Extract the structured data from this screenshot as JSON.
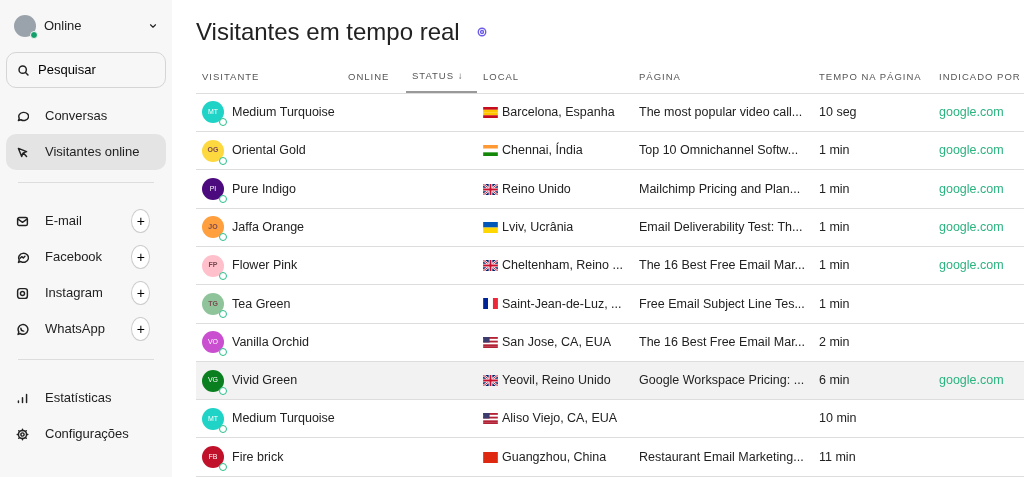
{
  "user": {
    "status": "Online",
    "online": true
  },
  "search": {
    "label": "Pesquisar"
  },
  "nav_sections": [
    {
      "items": [
        {
          "label": "Conversas",
          "kind": "chat",
          "selected": false
        },
        {
          "label": "Visitantes online",
          "kind": "cursor",
          "selected": true
        }
      ]
    },
    {
      "items": [
        {
          "label": "E-mail",
          "kind": "mail",
          "selected": false,
          "add_label": "+"
        },
        {
          "label": "Facebook",
          "kind": "messenger",
          "selected": false,
          "add_label": "+"
        },
        {
          "label": "Instagram",
          "kind": "instagram",
          "selected": false,
          "add_label": "+"
        },
        {
          "label": "WhatsApp",
          "kind": "whatsapp",
          "selected": false,
          "add_label": "+"
        }
      ]
    },
    {
      "items": [
        {
          "label": "Estatísticas",
          "kind": "bars",
          "selected": false
        },
        {
          "label": "Configurações",
          "kind": "gear",
          "selected": false
        }
      ]
    }
  ],
  "page_title": "Visitantes em tempo real",
  "table": {
    "columns": [
      {
        "label": "VISITANTE",
        "sorted": false
      },
      {
        "label": "ONLINE",
        "sorted": false
      },
      {
        "label": "STATUS",
        "sorted": true,
        "sort_arrow": "↓"
      },
      {
        "label": "LOCAL",
        "sorted": false
      },
      {
        "label": "PÁGINA",
        "sorted": false
      },
      {
        "label": "TEMPO NA PÁGINA",
        "sorted": false
      },
      {
        "label": "INDICADO POR",
        "sorted": false
      }
    ],
    "rows": [
      {
        "initials": "MT",
        "color": "#1fd3c6",
        "name": "Medium Turquoise",
        "online": true,
        "flag": {
          "kind": "spain"
        },
        "location": "Barcelona, Espanha",
        "page": "The most popular video call...",
        "time": "10 seg",
        "referrer": "google.com",
        "selected": false
      },
      {
        "initials": "OG",
        "color": "#fdd83f",
        "name": "Oriental Gold",
        "online": true,
        "flag": {
          "kind": "india"
        },
        "location": "Chennai, Índia",
        "page": "Top 10 Omnichannel Softw...",
        "time": "1 min",
        "referrer": "google.com",
        "selected": false
      },
      {
        "initials": "PI",
        "color": "#4b0a7d",
        "name": "Pure Indigo",
        "online": true,
        "flag": {
          "kind": "uk"
        },
        "location": "Reino Unido",
        "page": "Mailchimp Pricing and Plan...",
        "time": "1 min",
        "referrer": "google.com",
        "selected": false
      },
      {
        "initials": "JO",
        "color": "#ff9f3d",
        "name": "Jaffa Orange",
        "online": true,
        "flag": {
          "kind": "ukraine"
        },
        "location": "Lviv, Ucrânia",
        "page": "Email Deliverability Test: Th...",
        "time": "1 min",
        "referrer": "google.com",
        "selected": false
      },
      {
        "initials": "FP",
        "color": "#ffc0cb",
        "name": "Flower Pink",
        "online": true,
        "flag": {
          "kind": "uk"
        },
        "location": "Cheltenham, Reino ...",
        "page": "The 16 Best Free Email Mar...",
        "time": "1 min",
        "referrer": "google.com",
        "selected": false
      },
      {
        "initials": "TG",
        "color": "#8fc49a",
        "name": "Tea Green",
        "online": true,
        "flag": {
          "kind": "france"
        },
        "location": "Saint-Jean-de-Luz, ...",
        "page": "Free Email Subject Line Tes...",
        "time": "1 min",
        "selected": false
      },
      {
        "initials": "VO",
        "color": "#c94fd0",
        "name": "Vanilla Orchid",
        "online": true,
        "flag": {
          "kind": "usa"
        },
        "location": "San Jose, CA, EUA",
        "page": "The 16 Best Free Email Mar...",
        "time": "2 min",
        "selected": false
      },
      {
        "initials": "VG",
        "color": "#0a7f1f",
        "name": "Vivid Green",
        "online": true,
        "flag": {
          "kind": "uk"
        },
        "location": "Yeovil, Reino Unido",
        "page": "Google Workspace Pricing: ...",
        "time": "6 min",
        "referrer": "google.com",
        "selected": true
      },
      {
        "initials": "MT",
        "color": "#1fd3c6",
        "name": "Medium Turquoise",
        "online": true,
        "flag": {
          "kind": "usa"
        },
        "location": "Aliso Viejo, CA, EUA",
        "time": "10 min",
        "selected": false
      },
      {
        "initials": "FB",
        "color": "#c0102a",
        "name": "Fire brick",
        "online": true,
        "flag": {
          "kind": "china"
        },
        "location": "Guangzhou, China",
        "page": "Restaurant Email Marketing...",
        "time": "11 min",
        "selected": false
      }
    ]
  }
}
